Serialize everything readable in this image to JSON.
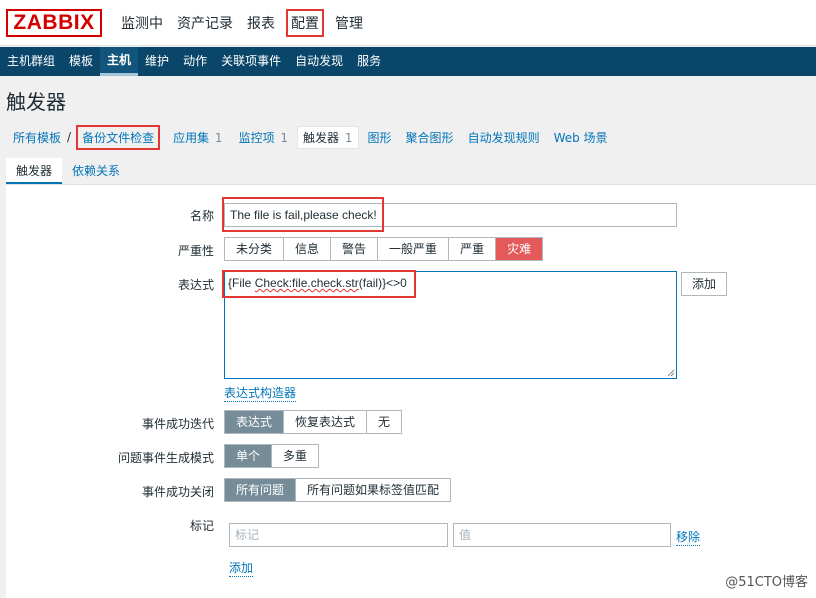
{
  "header": {
    "logo": "ZABBIX",
    "menu": [
      {
        "label": "监测中",
        "active": false
      },
      {
        "label": "资产记录",
        "active": false
      },
      {
        "label": "报表",
        "active": false
      },
      {
        "label": "配置",
        "active": true
      },
      {
        "label": "管理",
        "active": false
      }
    ]
  },
  "submenu": [
    "主机群组",
    "模板",
    "主机",
    "维护",
    "动作",
    "关联项事件",
    "自动发现",
    "服务"
  ],
  "page_title": "触发器",
  "breadcrumb": {
    "all_templates": "所有模板",
    "separator": "/",
    "host": "备份文件检查",
    "items": [
      {
        "label": "应用集",
        "count": "1"
      },
      {
        "label": "监控项",
        "count": "1"
      },
      {
        "label": "触发器",
        "count": "1"
      },
      {
        "label": "图形",
        "count": ""
      },
      {
        "label": "聚合图形",
        "count": ""
      },
      {
        "label": "自动发现规则",
        "count": ""
      },
      {
        "label": "Web 场景",
        "count": ""
      }
    ]
  },
  "tabs": [
    "触发器",
    "依赖关系"
  ],
  "form": {
    "name_label": "名称",
    "name_value": "The file is fail,please check!",
    "severity_label": "严重性",
    "severity_options": [
      "未分类",
      "信息",
      "警告",
      "一般严重",
      "严重",
      "灾难"
    ],
    "severity_selected": "灾难",
    "expression_label": "表达式",
    "expression_parts": [
      "{File ",
      "Check:file.check.str",
      "(fail)}<>0"
    ],
    "add_button": "添加",
    "expression_builder": "表达式构造器",
    "ok_event_label": "事件成功迭代",
    "ok_event_options": [
      "表达式",
      "恢复表达式",
      "无"
    ],
    "mode_label": "问题事件生成模式",
    "mode_options": [
      "单个",
      "多重"
    ],
    "close_label": "事件成功关闭",
    "close_options": [
      "所有问题",
      "所有问题如果标签值匹配"
    ],
    "tags_label": "标记",
    "tag_placeholder": "标记",
    "value_placeholder": "值",
    "remove_link": "移除",
    "add_link": "添加"
  },
  "watermark": "@51CTO博客",
  "colors": {
    "nav_bg": "#0a466a",
    "highlight": "#e33734",
    "disaster": "#e45959",
    "link": "#0275b8"
  }
}
